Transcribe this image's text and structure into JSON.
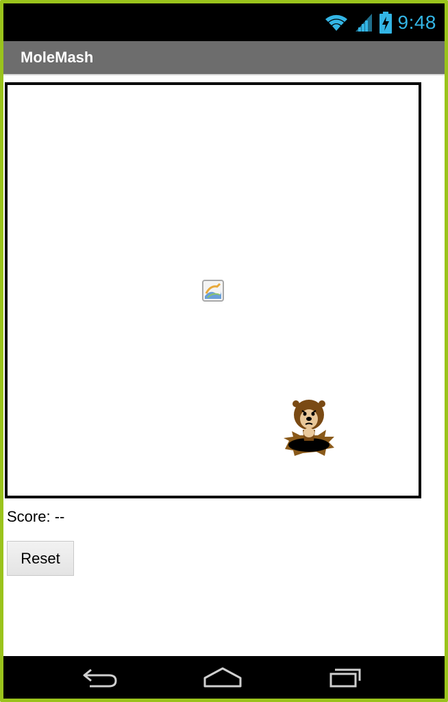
{
  "status_bar": {
    "time": "9:48",
    "icons": [
      "wifi-icon",
      "signal-icon",
      "battery-charging-icon"
    ],
    "accent_color": "#33b5e5"
  },
  "app": {
    "title": "MoleMash"
  },
  "canvas": {
    "sprites": [
      "broken-image-icon",
      "mole-icon"
    ]
  },
  "score": {
    "text": "Score: --"
  },
  "controls": {
    "reset_label": "Reset"
  },
  "nav_bar": {
    "buttons": [
      "back-icon",
      "home-icon",
      "recents-icon"
    ]
  },
  "colors": {
    "frame": "#9ac31c",
    "title_bar": "#6d6d6d"
  }
}
